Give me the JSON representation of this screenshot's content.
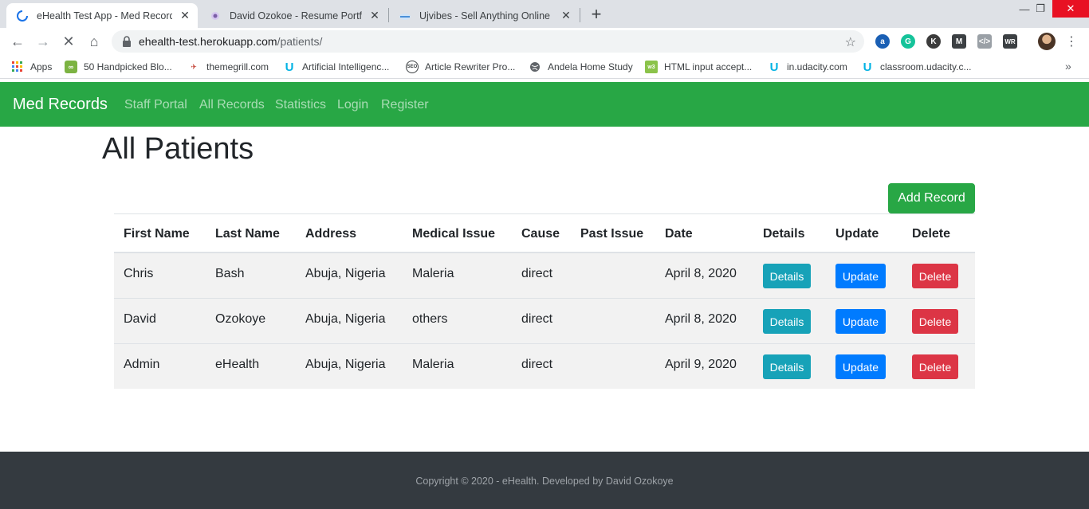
{
  "browser": {
    "tabs": [
      {
        "title": "eHealth Test App - Med Records",
        "active": true
      },
      {
        "title": "David Ozokoe - Resume Portfolio",
        "active": false
      },
      {
        "title": "Ujvibes - Sell Anything Online - S",
        "active": false
      }
    ],
    "close_glyph": "✕",
    "newtab_glyph": "+",
    "window": {
      "minimize": "—",
      "restore": "❐",
      "close": "✕"
    },
    "url_host": "ehealth-test.herokuapp.com",
    "url_path": "/patients/",
    "star_glyph": "☆",
    "menu_glyph": "⋮",
    "bookmarks": [
      {
        "label": "Apps",
        "icon": "apps-grid-icon"
      },
      {
        "label": "50 Handpicked Blo...",
        "icon": "link-icon"
      },
      {
        "label": "themegrill.com",
        "icon": "themegrill-icon"
      },
      {
        "label": "Artificial Intelligenc...",
        "icon": "udacity-icon"
      },
      {
        "label": "Article Rewriter Pro...",
        "icon": "seo-icon"
      },
      {
        "label": "Andela Home Study",
        "icon": "globe-icon"
      },
      {
        "label": "HTML input accept...",
        "icon": "html-icon"
      },
      {
        "label": "in.udacity.com",
        "icon": "udacity-icon"
      },
      {
        "label": "classroom.udacity.c...",
        "icon": "udacity-icon"
      }
    ],
    "bookmarks_more": "»",
    "nav_glyphs": {
      "back": "←",
      "forward": "→",
      "stop": "✕",
      "home": "⌂"
    }
  },
  "navbar": {
    "brand": "Med Records",
    "links": [
      "Staff Portal",
      "All Records",
      "Statistics",
      "Login",
      "Register"
    ]
  },
  "main": {
    "title": "All Patients",
    "add_button": "Add Record",
    "table": {
      "headers": [
        "First Name",
        "Last Name",
        "Address",
        "Medical Issue",
        "Cause",
        "Past Issue",
        "Date",
        "Details",
        "Update",
        "Delete"
      ],
      "rows": [
        {
          "first": "Chris",
          "last": "Bash",
          "address": "Abuja, Nigeria",
          "issue": "Maleria",
          "cause": "direct",
          "past": "",
          "date": "April 8, 2020"
        },
        {
          "first": "David",
          "last": "Ozokoye",
          "address": "Abuja, Nigeria",
          "issue": "others",
          "cause": "direct",
          "past": "",
          "date": "April 8, 2020"
        },
        {
          "first": "Admin",
          "last": "eHealth",
          "address": "Abuja, Nigeria",
          "issue": "Maleria",
          "cause": "direct",
          "past": "",
          "date": "April 9, 2020"
        }
      ],
      "row_buttons": {
        "details": "Details",
        "update": "Update",
        "delete": "Delete"
      }
    }
  },
  "footer": {
    "text": "Copyright © 2020 - eHealth. Developed by David Ozokoye"
  },
  "colors": {
    "navbar": "#28a745",
    "details": "#17a2b8",
    "update": "#007bff",
    "delete": "#dc3545",
    "footer": "#343a40"
  }
}
